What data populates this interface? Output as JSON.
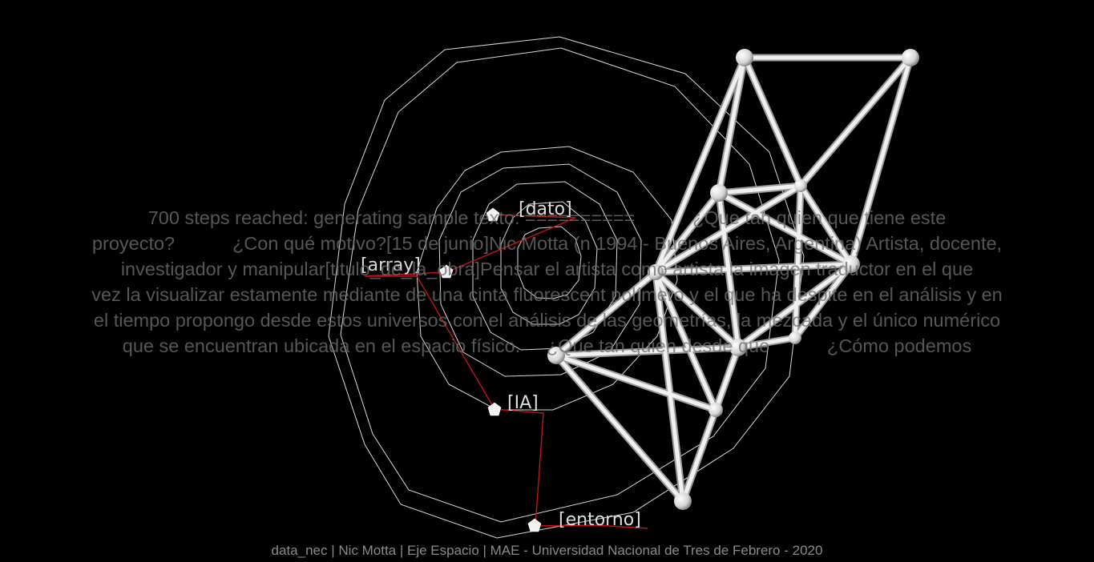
{
  "nodes": [
    {
      "id": "dato",
      "label": "[dato]"
    },
    {
      "id": "array",
      "label": "[array]"
    },
    {
      "id": "ia",
      "label": "[IA]"
    },
    {
      "id": "entorno",
      "label": "[entorno]"
    }
  ],
  "generated_text": {
    "lines": [
      "700 steps reached: generating sample texto: ==========           ¿Que tan quien que tiene este",
      "proyecto?           ¿Con qué motivo?[15 de junio]Nic Motta (n 1994 - Buenos Aires, Argentina) Artista, docente,",
      "investigador y manipular[titulo_de_la_obra]Pensar el artista como artista la imagen traductor en el que",
      "vez la visualizar estamente mediante de una cinta fluorescent polímero y el que ha despite en el análisis y en",
      "el tiempo propongo desde estos universos con el análisis de las geometrías, la mezcada y el único numérico",
      "que se encuentran ubicada en el espacio físico.     ¿Que tan quien desde que           ¿Cómo podemos"
    ]
  },
  "footer": {
    "credit": "data_nec | Nic Motta | Eje Espacio | MAE - Universidad Nacional de Tres de Febrero - 2020"
  },
  "colors": {
    "background": "#000000",
    "orbit_lines": "#d8d8d8",
    "path_line": "#c0141a",
    "structure": "#eaeaea",
    "text": "#6f6f6f"
  }
}
